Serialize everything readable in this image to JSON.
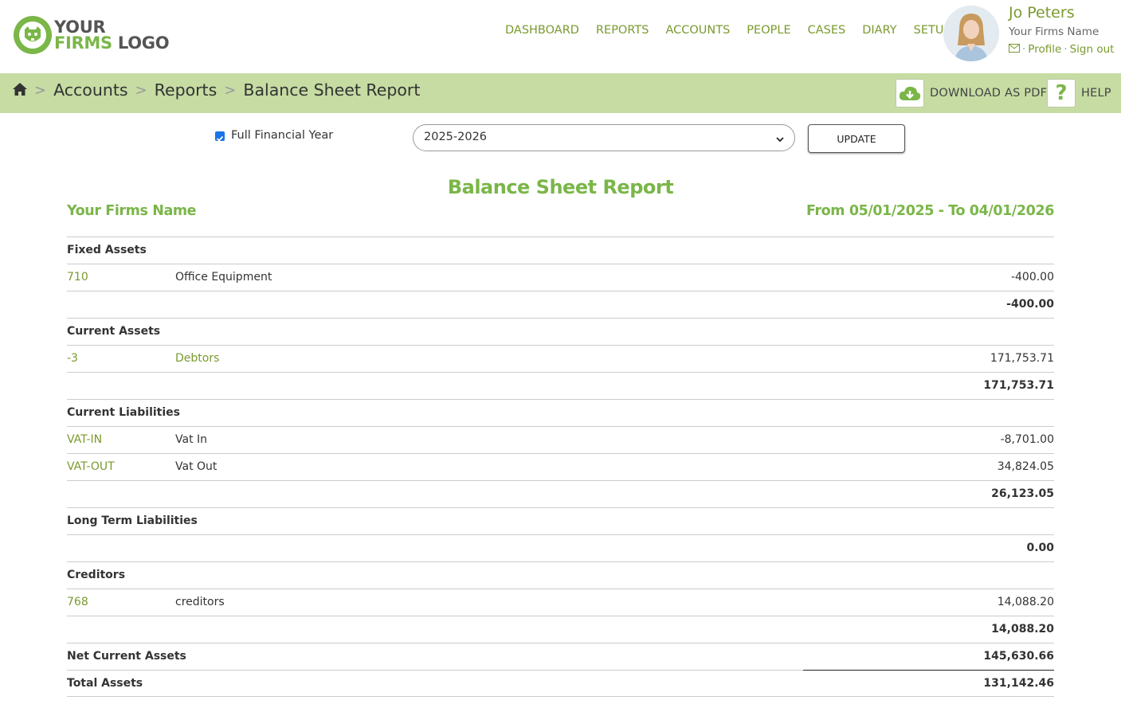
{
  "logo": {
    "line1": "YOUR",
    "line2a": "FIRMS",
    "line2b": "LOGO"
  },
  "nav": [
    "DASHBOARD",
    "REPORTS",
    "ACCOUNTS",
    "PEOPLE",
    "CASES",
    "DIARY",
    "SETUP"
  ],
  "user": {
    "name": "Jo Peters",
    "firm": "Your Firms Name",
    "profile": "Profile",
    "signout": "Sign out",
    "sep": "·"
  },
  "breadcrumb": {
    "items": [
      "Accounts",
      "Reports",
      "Balance Sheet Report"
    ],
    "sep": ">"
  },
  "actions": {
    "download": "DOWNLOAD AS PDF",
    "help": "HELP"
  },
  "filters": {
    "full_year_label": "Full Financial Year",
    "full_year_checked": true,
    "year": "2025-2026",
    "update": "UPDATE"
  },
  "report": {
    "title": "Balance Sheet Report",
    "firm": "Your Firms Name",
    "range": "From 05/01/2025 - To 04/01/2026",
    "rows": [
      {
        "type": "head",
        "label": "Fixed Assets"
      },
      {
        "type": "item",
        "code": "710",
        "name": "Office Equipment",
        "name_link": false,
        "amount": "-400.00"
      },
      {
        "type": "total",
        "amount": "-400.00"
      },
      {
        "type": "head",
        "label": "Current Assets"
      },
      {
        "type": "item",
        "code": "-3",
        "name": "Debtors",
        "name_link": true,
        "amount": "171,753.71"
      },
      {
        "type": "total",
        "amount": "171,753.71"
      },
      {
        "type": "head",
        "label": "Current Liabilities"
      },
      {
        "type": "item",
        "code": "VAT-IN",
        "name": "Vat In",
        "name_link": false,
        "amount": "-8,701.00"
      },
      {
        "type": "item",
        "code": "VAT-OUT",
        "name": "Vat Out",
        "name_link": false,
        "amount": "34,824.05"
      },
      {
        "type": "total",
        "amount": "26,123.05"
      },
      {
        "type": "head",
        "label": "Long Term Liabilities"
      },
      {
        "type": "total",
        "amount": "0.00"
      },
      {
        "type": "head",
        "label": "Creditors"
      },
      {
        "type": "item",
        "code": "768",
        "name": "creditors",
        "name_link": false,
        "amount": "14,088.20"
      },
      {
        "type": "total",
        "amount": "14,088.20"
      },
      {
        "type": "net",
        "label": "Net Current Assets",
        "amount": "145,630.66"
      },
      {
        "type": "tot",
        "label": "Total Assets",
        "amount": "131,142.46"
      }
    ]
  },
  "colors": {
    "accent": "#7ab648",
    "link": "#7a9a2e",
    "bar": "#c6dca3"
  }
}
